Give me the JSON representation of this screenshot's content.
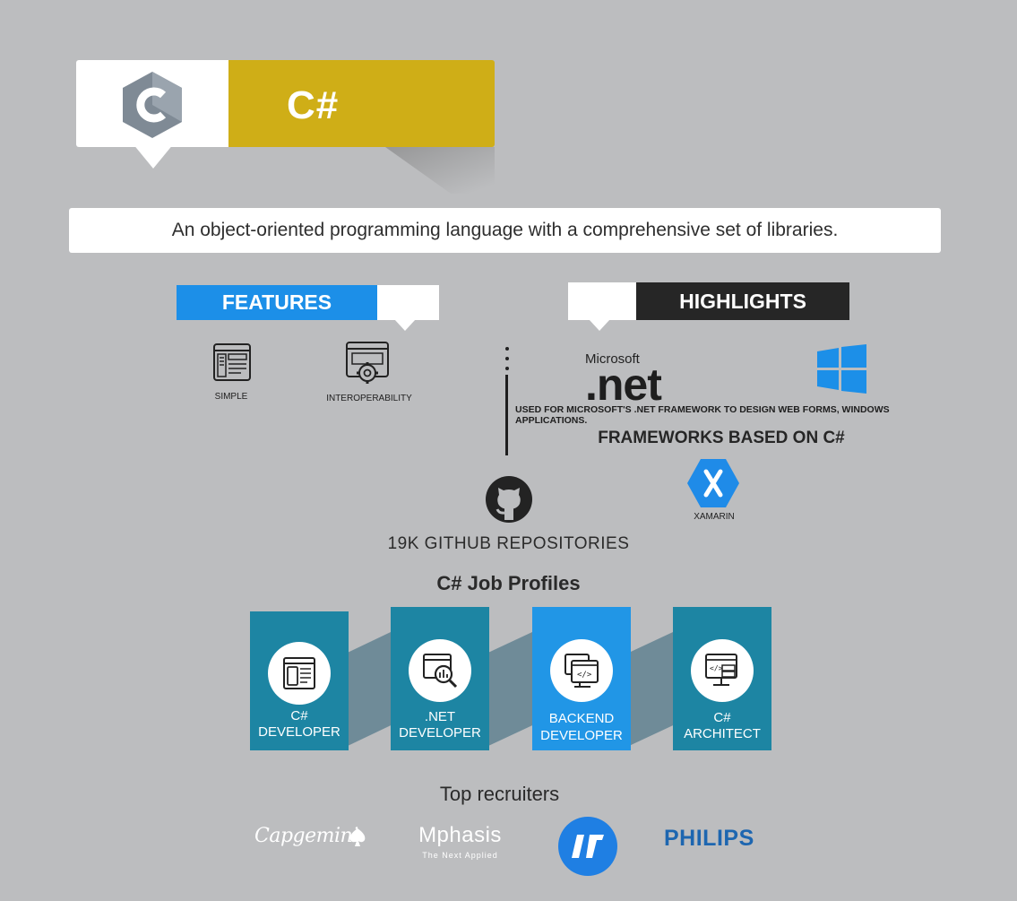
{
  "header": {
    "language": "C#",
    "description": "An object-oriented programming language with a comprehensive set of libraries."
  },
  "features": {
    "title": "FEATURES",
    "items": [
      {
        "label": "SIMPLE",
        "icon": "simple-window-icon"
      },
      {
        "label": "INTEROPERABILITY",
        "icon": "gear-window-icon"
      }
    ]
  },
  "highlights": {
    "title": "HIGHLIGHTS",
    "microsoft_label": "Microsoft",
    "net_label": ".net",
    "caption": "USED FOR MICROSOFT'S .NET FRAMEWORK TO DESIGN WEB FORMS, WINDOWS APPLICATIONS.",
    "frameworks_title": "FRAMEWORKS BASED ON C#",
    "framework": "XAMARIN"
  },
  "github": {
    "label": "19K GITHUB REPOSITORIES"
  },
  "jobs": {
    "title": "C# Job Profiles",
    "items": [
      {
        "line1": "C#",
        "line2": "DEVELOPER"
      },
      {
        "line1": ".NET",
        "line2": "DEVELOPER"
      },
      {
        "line1": "BACKEND",
        "line2": "DEVELOPER"
      },
      {
        "line1": "C#",
        "line2": "ARCHITECT"
      }
    ]
  },
  "recruiters": {
    "title": "Top recruiters",
    "capgemini": "Capgemini",
    "mphasis": "Mphasis",
    "mphasis_tagline": "The Next Applied",
    "philips": "PHILIPS"
  },
  "colors": {
    "background": "#bcbdbf",
    "gold": "#cfae17",
    "features_blue": "#1c8fe8",
    "highlights_dark": "#262626",
    "card_teal": "#1d85a3",
    "card_blue": "#2196e6",
    "philips_blue": "#1d66b0"
  }
}
